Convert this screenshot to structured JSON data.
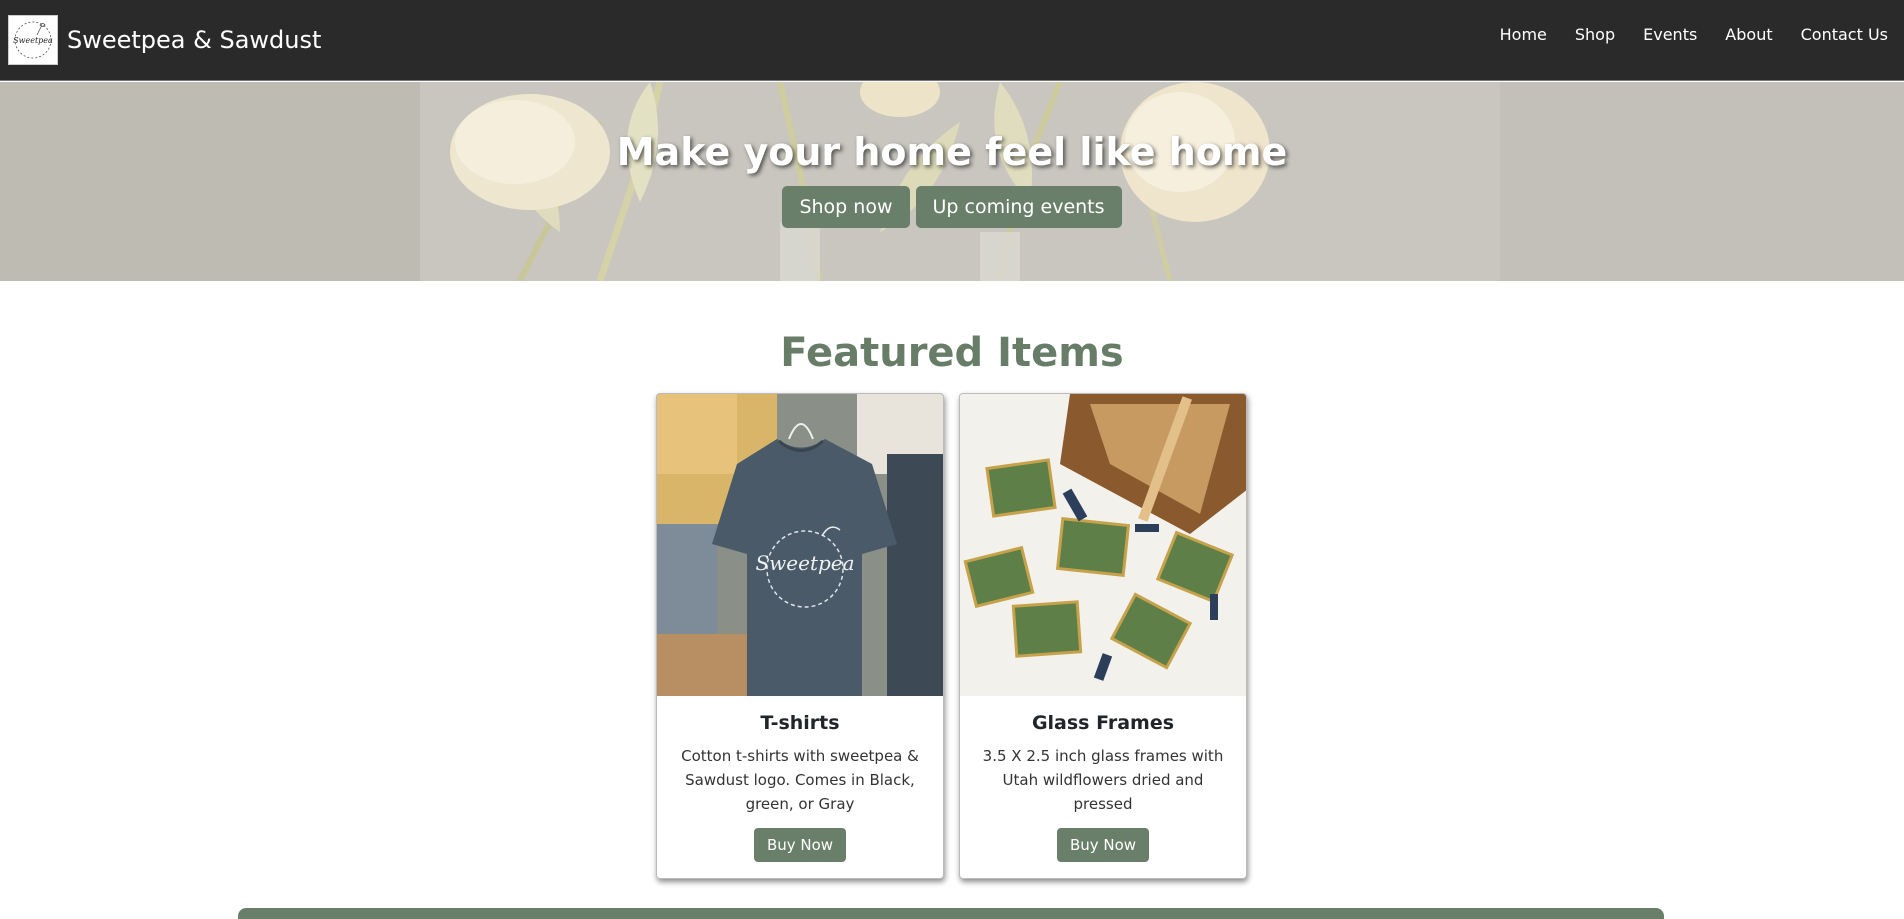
{
  "brand": {
    "name": "Sweetpea & Sawdust",
    "logo_text": "Sweetpea"
  },
  "nav": {
    "items": [
      "Home",
      "Shop",
      "Events",
      "About",
      "Contact Us"
    ]
  },
  "hero": {
    "title": "Make your home feel like home",
    "buttons": [
      "Shop now",
      "Up coming events"
    ]
  },
  "featured": {
    "title": "Featured Items",
    "cards": [
      {
        "title": "T-shirts",
        "text": "Cotton t-shirts with sweetpea & Sawdust logo. Comes in Black, green, or Gray",
        "button": "Buy Now",
        "image_logo": "Sweetpea"
      },
      {
        "title": "Glass Frames",
        "text": "3.5 X 2.5 inch glass frames with Utah wildflowers dried and pressed",
        "button": "Buy Now"
      }
    ]
  },
  "colors": {
    "navbar": "#2a2a2a",
    "accent": "#6a7f6a",
    "heading": "#687d68"
  }
}
